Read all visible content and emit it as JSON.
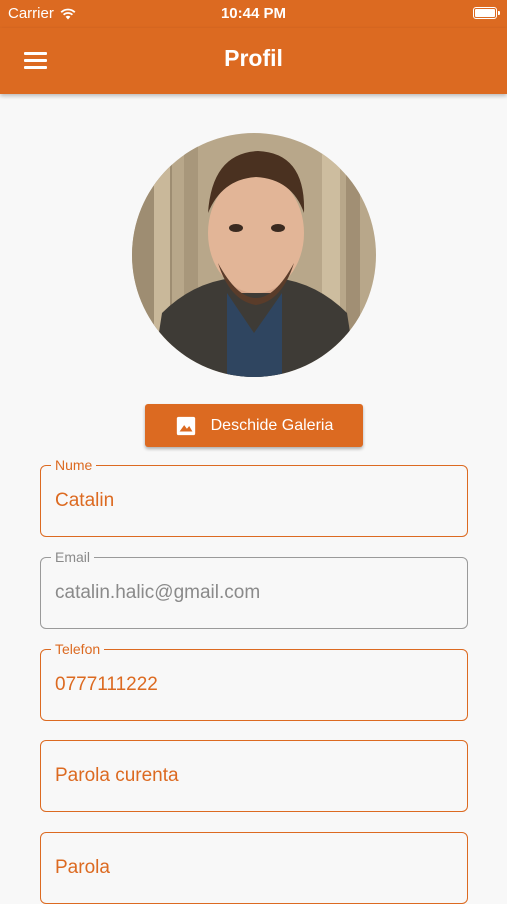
{
  "status_bar": {
    "carrier": "Carrier",
    "time": "10:44 PM"
  },
  "app_bar": {
    "title": "Profil"
  },
  "gallery_button": {
    "label": "Deschide Galeria"
  },
  "form": {
    "name": {
      "label": "Nume",
      "value": "Catalin"
    },
    "email": {
      "label": "Email",
      "value": "catalin.halic@gmail.com"
    },
    "phone": {
      "label": "Telefon",
      "value": "0777111222"
    },
    "current_password": {
      "placeholder": "Parola curenta"
    },
    "password": {
      "placeholder": "Parola"
    }
  },
  "colors": {
    "accent": "#dc6a21",
    "background": "#f8f8f8",
    "disabled": "#8a8a8a"
  },
  "icons": [
    "wifi-icon",
    "battery-icon",
    "menu-icon",
    "image-icon"
  ]
}
